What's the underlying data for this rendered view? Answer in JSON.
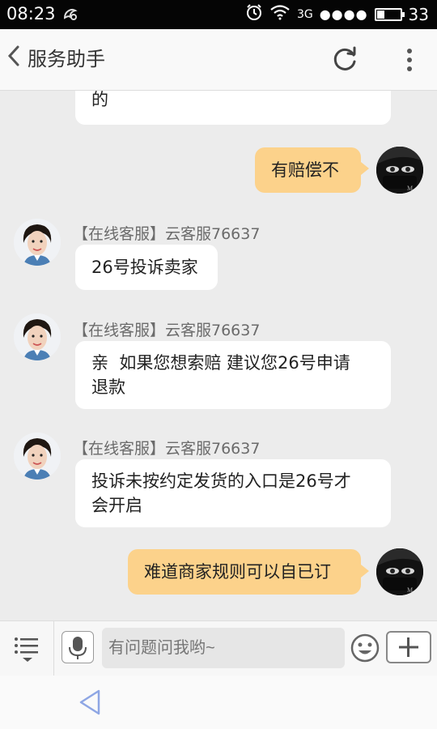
{
  "status_bar": {
    "time": "08:23",
    "network": "3G",
    "signal_dots": "●●●●",
    "battery_level": "33",
    "battery_fraction": 0.33
  },
  "header": {
    "title": "服务助手"
  },
  "messages": [
    {
      "from": "agent",
      "sender": "",
      "text": "的"
    },
    {
      "from": "user",
      "text": "有赔偿不"
    },
    {
      "from": "agent",
      "sender": "【在线客服】云客服76637",
      "text": "26号投诉卖家"
    },
    {
      "from": "agent",
      "sender": "【在线客服】云客服76637",
      "lines": [
        "亲  如果您想索赔 建议您26号申请",
        "退款"
      ]
    },
    {
      "from": "agent",
      "sender": "【在线客服】云客服76637",
      "lines": [
        "投诉未按约定发货的入口是26号才",
        "会开启"
      ]
    },
    {
      "from": "user",
      "text": "难道商家规则可以自已订"
    }
  ],
  "input": {
    "placeholder": "有问题问我哟~"
  },
  "colors": {
    "user_bubble": "#fcd28b",
    "agent_bubble": "#ffffff",
    "chat_background": "#ececec"
  },
  "icons": [
    "back-arrow-icon",
    "refresh-icon",
    "more-vert-icon",
    "menu-list-icon",
    "microphone-icon",
    "emoji-icon",
    "plus-icon",
    "nav-back-icon"
  ]
}
